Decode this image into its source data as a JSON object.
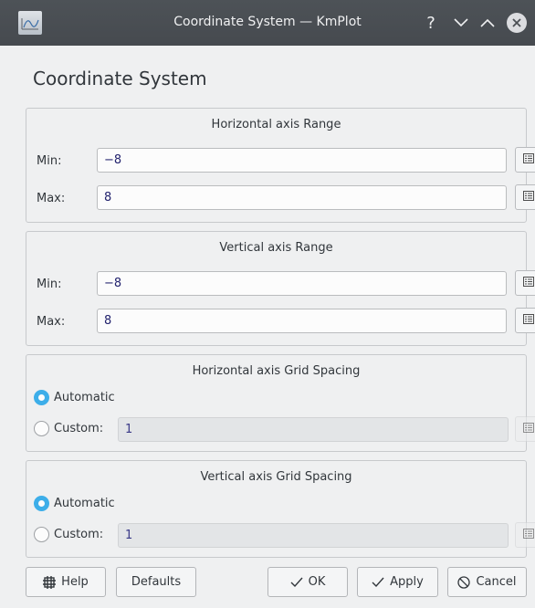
{
  "window": {
    "title": "Coordinate System — KmPlot",
    "help_glyph": "?"
  },
  "header": {
    "title": "Coordinate System"
  },
  "horizontal_range": {
    "title": "Horizontal axis Range",
    "min_label": "Min:",
    "min_value": "−8",
    "max_label": "Max:",
    "max_value": "8"
  },
  "vertical_range": {
    "title": "Vertical axis Range",
    "min_label": "Min:",
    "min_value": "−8",
    "max_label": "Max:",
    "max_value": "8"
  },
  "horizontal_grid": {
    "title": "Horizontal axis Grid Spacing",
    "automatic_label": "Automatic",
    "custom_label": "Custom:",
    "custom_value": "1",
    "selected": "automatic"
  },
  "vertical_grid": {
    "title": "Vertical axis Grid Spacing",
    "automatic_label": "Automatic",
    "custom_label": "Custom:",
    "custom_value": "1",
    "selected": "automatic"
  },
  "buttons": {
    "help": "Help",
    "defaults": "Defaults",
    "ok": "OK",
    "apply": "Apply",
    "cancel": "Cancel"
  },
  "colors": {
    "accent": "#3daee9",
    "titlebar": "#4b4f54",
    "window_bg": "#eff0f1"
  }
}
